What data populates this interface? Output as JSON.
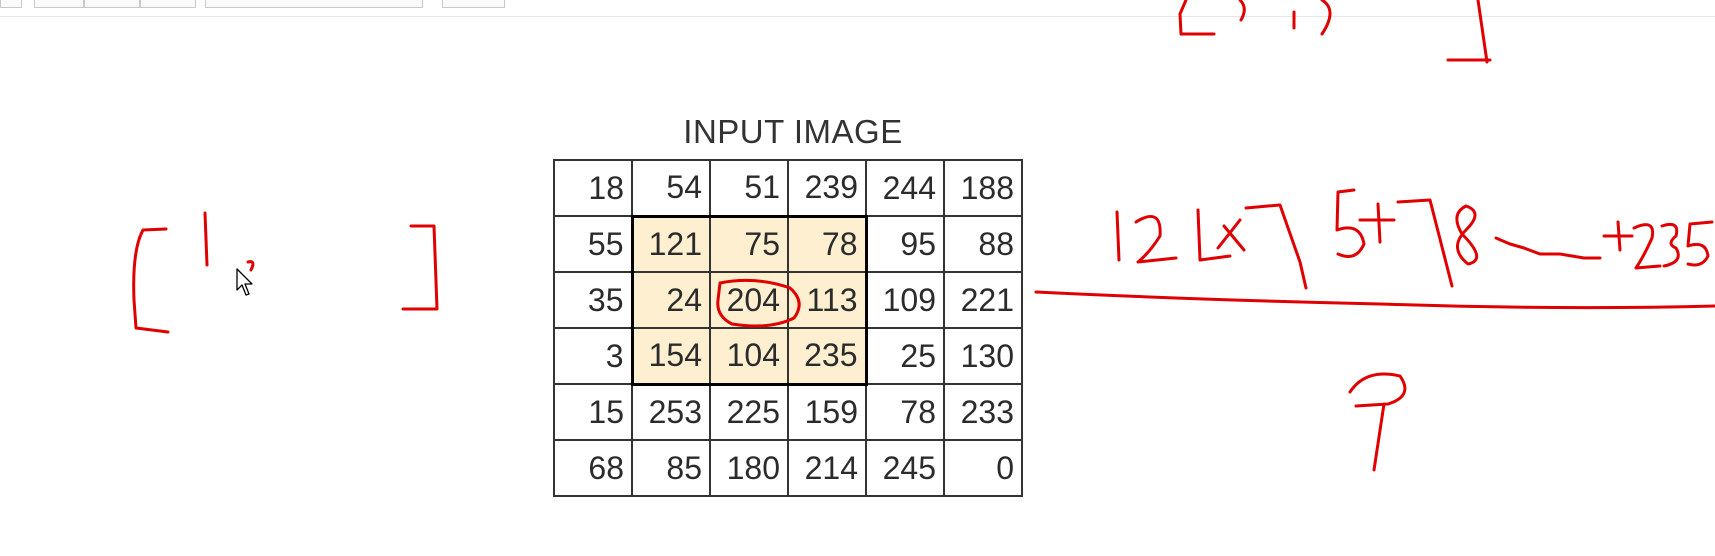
{
  "figure": {
    "title": "INPUT IMAGE",
    "rows": [
      [
        "18",
        "54",
        "51",
        "239",
        "244",
        "188"
      ],
      [
        "55",
        "121",
        "75",
        "78",
        "95",
        "88"
      ],
      [
        "35",
        "24",
        "204",
        "113",
        "109",
        "221"
      ],
      [
        "3",
        "154",
        "104",
        "235",
        "25",
        "130"
      ],
      [
        "15",
        "253",
        "225",
        "159",
        "78",
        "233"
      ],
      [
        "68",
        "85",
        "180",
        "214",
        "245",
        "0"
      ]
    ],
    "highlight_color": "#fdefcf",
    "annotation_color": "#e00000"
  }
}
